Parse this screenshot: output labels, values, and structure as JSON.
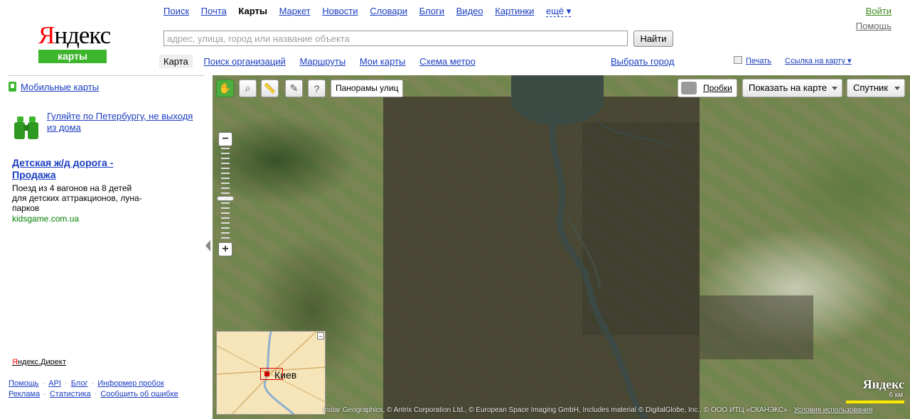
{
  "header": {
    "logo": {
      "first_letter": "Я",
      "rest": "ндекс",
      "sub": "карты"
    },
    "services": [
      "Поиск",
      "Почта",
      "Карты",
      "Маркет",
      "Новости",
      "Словари",
      "Блоги",
      "Видео",
      "Картинки"
    ],
    "services_more": "ещё ▾",
    "login": "Войти",
    "help": "Помощь",
    "search": {
      "placeholder": "адрес, улица, город или название объекта",
      "value": "",
      "button": "Найти"
    },
    "tabs": [
      "Карта",
      "Поиск организаций",
      "Маршруты",
      "Мои карты",
      "Схема метро"
    ],
    "choose_city": "Выбрать город",
    "print": "Печать",
    "map_link": "Ссылка на карту ▾"
  },
  "sidebar": {
    "mobile": "Мобильные карты",
    "promo": "Гуляйте по Петербургу, не выходя из дома",
    "ad": {
      "title": "Детская ж/д дорога - Продажа",
      "text": "Поезд из 4 вагонов на 8 детей для детских аттракционов, луна-парков",
      "domain": "kidsgame.com.ua"
    },
    "direct": {
      "first": "Я",
      "rest": "ндекс.Директ"
    },
    "footer1": [
      "Помощь",
      "API",
      "Блог",
      "Информер пробок"
    ],
    "footer2": [
      "Реклама",
      "Статистика",
      "Сообщить об ошибке"
    ]
  },
  "map": {
    "panorama_label": "Панорамы улиц",
    "traffic": "Пробки",
    "show_on_map": "Показать на карте",
    "layer": "Спутник",
    "minimap_city": "Киев",
    "brand": "Яндекс",
    "scale": "6 км",
    "copyright": "Instar Geographics, © Antrix Corporation Ltd., © European Space Imaging GmbH, Includes material © DigitalGlobe, Inc., © ООО ИТЦ «СКАНЭКС»",
    "terms": "Условия использования"
  }
}
